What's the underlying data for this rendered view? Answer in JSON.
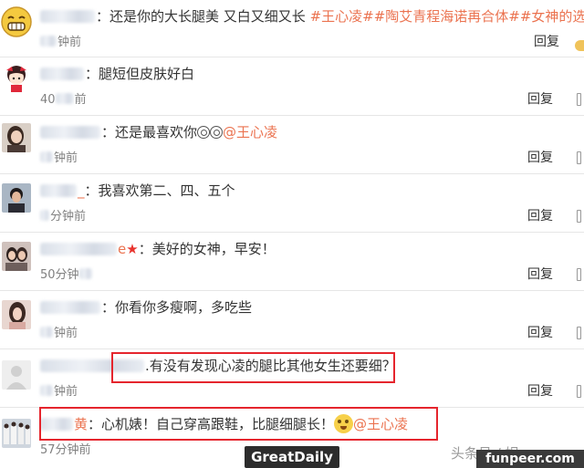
{
  "reply_label": "回复",
  "colors": {
    "accent": "#eb7350",
    "highlight": "#e5252d",
    "text": "#333333",
    "time": "#808080"
  },
  "comments": [
    {
      "name_visible": "",
      "colon": "：",
      "text": "还是你的大长腿美  又白又细又长 ",
      "topics": "#王心凌##陶艾青程海诺再合体##女神的选择#",
      "time": "钟前",
      "avatar_icon": "grinning-emoji-avatar"
    },
    {
      "name_visible": "",
      "colon": "：",
      "text": "腿短但皮肤好白",
      "time": "40",
      "time_suffix": "前",
      "avatar_icon": "cartoon-girl-avatar"
    },
    {
      "name_visible": "",
      "colon": "：",
      "text": "还是最喜欢你",
      "mention": "@王心凌",
      "time": "钟前",
      "avatar_icon": "photo-avatar"
    },
    {
      "name_visible": "_",
      "colon": "：",
      "text": "我喜欢第二、四、五个",
      "time": "分钟前",
      "avatar_icon": "photo-avatar"
    },
    {
      "name_visible": "e",
      "colon": "：",
      "text": "美好的女神，早安！",
      "time": "50分钟",
      "avatar_icon": "photo-avatar"
    },
    {
      "name_visible": "",
      "colon": "：",
      "text": "你看你多瘦啊，多吃些",
      "time": "钟前",
      "avatar_icon": "photo-avatar"
    },
    {
      "name_visible": "",
      "colon": "：",
      "text": "有没有发现心凌的腿比其他女生还要细？",
      "time": "钟前",
      "avatar_icon": "default-avatar"
    },
    {
      "name_visible": "黄",
      "colon": "：",
      "text": "心机婊！自己穿高跟鞋，比腿细腿长！",
      "mention": "@王心凌",
      "time": "57分钟前",
      "avatar_icon": "photo-avatar"
    }
  ],
  "watermarks": {
    "greatdaily": "GreatDaily",
    "funpeer": "funpeer.com",
    "toutiao": "头条号 / 娱"
  }
}
